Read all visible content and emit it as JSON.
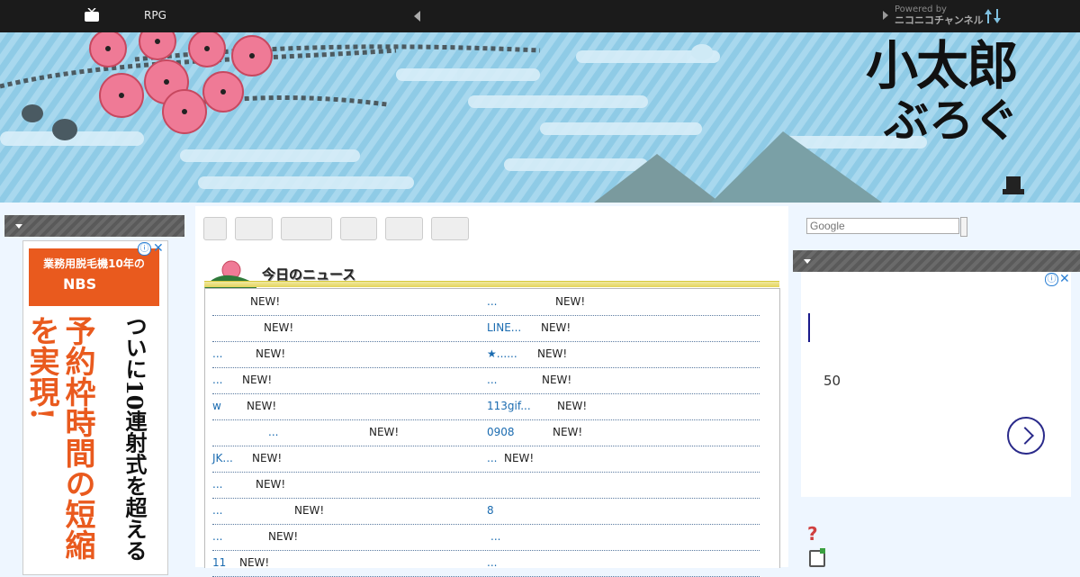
{
  "topbar": {
    "title": "RPG",
    "powered_by": "Powered by",
    "brand": "ニコニコチャンネル"
  },
  "banner": {
    "logo_line1": "小太郎",
    "logo_line2": "ぶろぐ"
  },
  "left_ad": {
    "top_text": "業務用脱毛機10年の",
    "logo": "NBS",
    "headline": "予約枠時間の短縮を実現!",
    "side": "ついに10連射式を超える"
  },
  "search": {
    "placeholder": "Google"
  },
  "news": {
    "title": "今日のニュース",
    "new_label": "NEW!",
    "rows": [
      {
        "l": "",
        "l_new": "NEW!",
        "r": "...",
        "r_new": "NEW!"
      },
      {
        "l": "",
        "l_new": "NEW!",
        "r": "LINE...",
        "r_new": "NEW!"
      },
      {
        "l": "...",
        "l_new": "NEW!",
        "r": "★......",
        "r_new": "NEW!"
      },
      {
        "l": "...",
        "l_new": "NEW!",
        "r": "...",
        "r_new": "NEW!"
      },
      {
        "l": "w",
        "l_new": "NEW!",
        "r": "113gif...",
        "r_new": "NEW!"
      },
      {
        "l": "...",
        "l_new": "NEW!",
        "r": "0908",
        "r_new": "NEW!"
      },
      {
        "l": "JK...",
        "l_new": "NEW!",
        "r": "...",
        "r_new": "NEW!"
      },
      {
        "l": "...",
        "l_new": "NEW!",
        "r": "",
        "r_new": ""
      },
      {
        "l": "...",
        "l_new": "NEW!",
        "r": "8",
        "r_new": ""
      },
      {
        "l": "...",
        "l_new": "NEW!",
        "r": "...",
        "r_new": ""
      },
      {
        "l": "11",
        "l_new": "NEW!",
        "r": "...",
        "r_new": ""
      }
    ]
  },
  "right_ad": {
    "number": "50"
  },
  "ad_controls": {
    "info": "ⓘ",
    "close": "✕"
  }
}
